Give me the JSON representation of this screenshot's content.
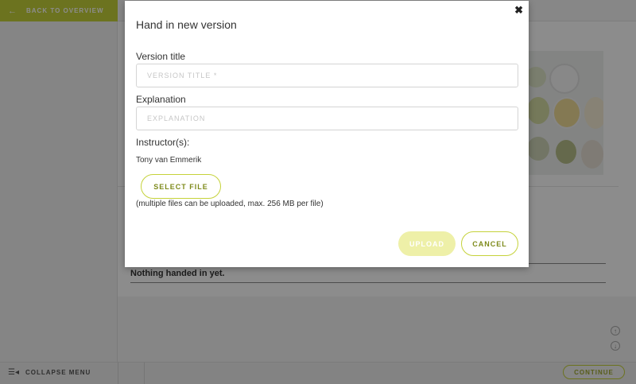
{
  "nav": {
    "back_label": "BACK TO OVERVIEW",
    "collapse_label": "COLLAPSE MENU",
    "continue_label": "CONTINUE"
  },
  "content": {
    "empty_state": "Nothing handed in yet."
  },
  "modal": {
    "title": "Hand in new version",
    "close_icon": "close-icon",
    "version_title_label": "Version title",
    "version_title_value": "",
    "version_title_placeholder": "VERSION TITLE *",
    "explanation_label": "Explanation",
    "explanation_value": "",
    "explanation_placeholder": "EXPLANATION",
    "instructors_label": "Instructor(s):",
    "instructor_name": "Tony van Emmerik",
    "select_file_label": "SELECT FILE",
    "upload_hint": "(multiple files can be uploaded, max. 256 MB per file)",
    "upload_label": "UPLOAD",
    "upload_enabled": false,
    "cancel_label": "CANCEL"
  },
  "colors": {
    "accent": "#c5d23a",
    "accent_text": "#7d8a1a",
    "upload_disabled": "#eef0a8",
    "overlay": "rgba(0,0,0,0.45)"
  }
}
